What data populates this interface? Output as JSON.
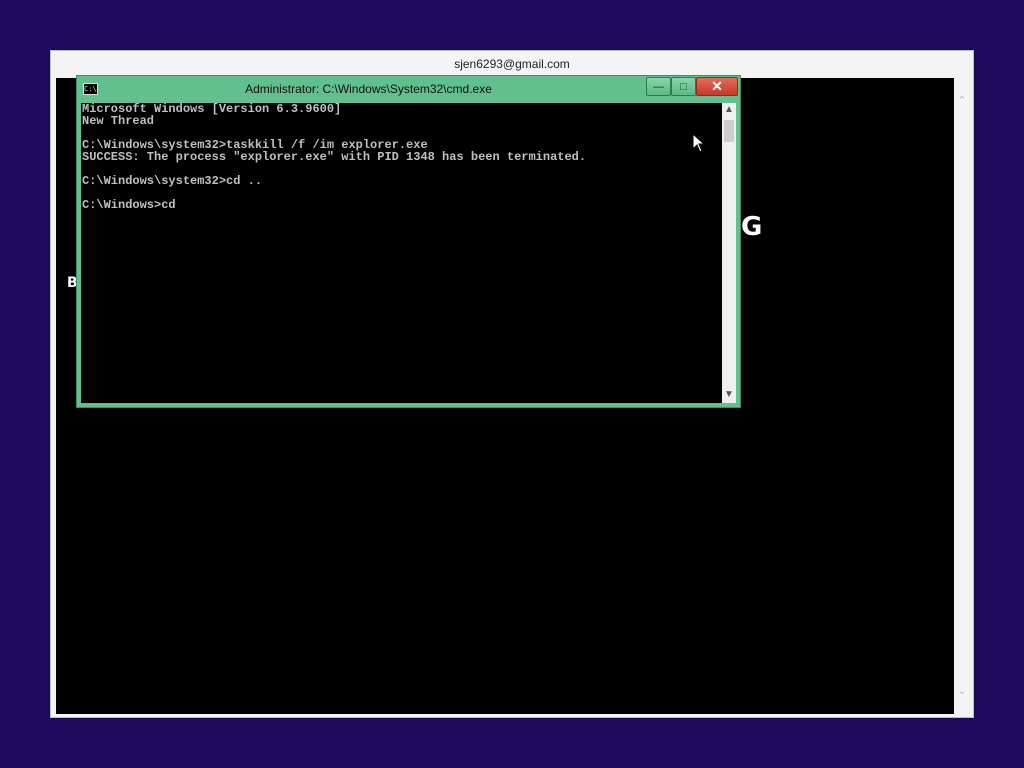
{
  "outer_window": {
    "title": "sjen6293@gmail.com",
    "background_fragments": {
      "left_char": "B",
      "right_char": "G"
    }
  },
  "cmd_window": {
    "title": "Administrator: C:\\Windows\\System32\\cmd.exe",
    "icon_label": "C:\\",
    "buttons": {
      "minimize": "—",
      "maximize": "□",
      "close": "✕"
    },
    "lines": [
      "Microsoft Windows [Version 6.3.9600]",
      "New Thread",
      "",
      "C:\\Windows\\system32>taskkill /f /im explorer.exe",
      "SUCCESS: The process \"explorer.exe\" with PID 1348 has been terminated.",
      "",
      "C:\\Windows\\system32>cd ..",
      "",
      "C:\\Windows>cd"
    ]
  },
  "colors": {
    "desktop": "#1e0a5a",
    "cmd_frame": "#62bf8e",
    "close_button": "#c7392a"
  }
}
